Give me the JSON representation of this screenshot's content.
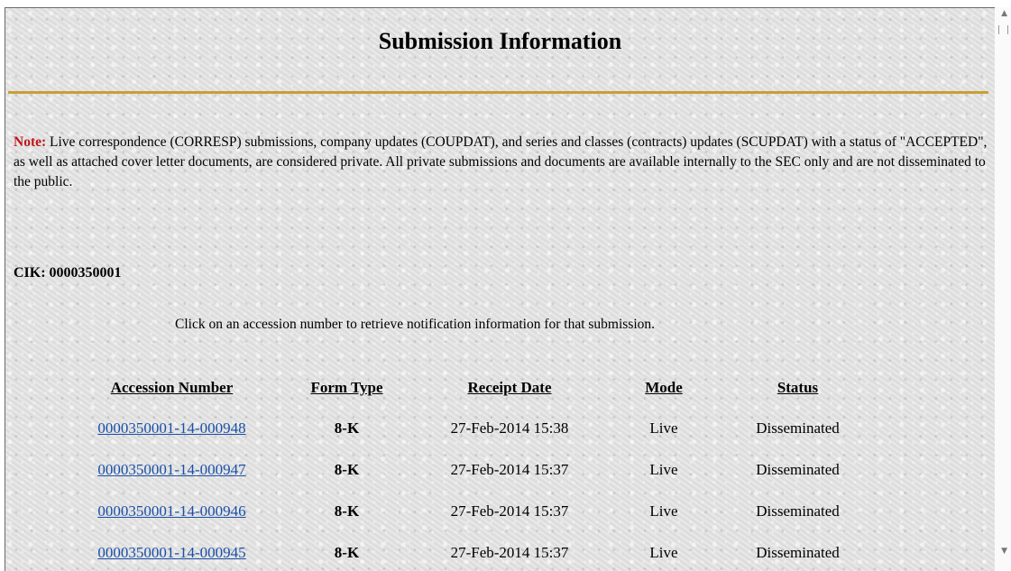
{
  "page": {
    "title": "Submission Information",
    "note_label": "Note:",
    "note_text": " Live correspondence (CORRESP) submissions, company updates (COUPDAT), and series and classes (contracts) updates (SCUPDAT) with a status of \"ACCEPTED\", as well as attached cover letter documents, are considered private. All private submissions and documents are available internally to the SEC only and are not disseminated to the public.",
    "cik": "CIK: 0000350001",
    "instruction": "Click on an accession number to retrieve notification information for that submission."
  },
  "table": {
    "headers": [
      "Accession Number",
      "Form Type",
      "Receipt Date",
      "Mode",
      "Status"
    ],
    "rows": [
      {
        "accession": "0000350001-14-000948",
        "form_type": "8-K",
        "receipt_date": "27-Feb-2014 15:38",
        "mode": "Live",
        "status": "Disseminated"
      },
      {
        "accession": "0000350001-14-000947",
        "form_type": "8-K",
        "receipt_date": "27-Feb-2014 15:37",
        "mode": "Live",
        "status": "Disseminated"
      },
      {
        "accession": "0000350001-14-000946",
        "form_type": "8-K",
        "receipt_date": "27-Feb-2014 15:37",
        "mode": "Live",
        "status": "Disseminated"
      },
      {
        "accession": "0000350001-14-000945",
        "form_type": "8-K",
        "receipt_date": "27-Feb-2014 15:37",
        "mode": "Live",
        "status": "Disseminated"
      }
    ]
  },
  "colors": {
    "note_label": "#c0151a",
    "rule": "#c8a033",
    "link": "#1a4fa8"
  },
  "icons": [
    "scroll-up-arrow-icon",
    "scroll-down-arrow-icon"
  ]
}
